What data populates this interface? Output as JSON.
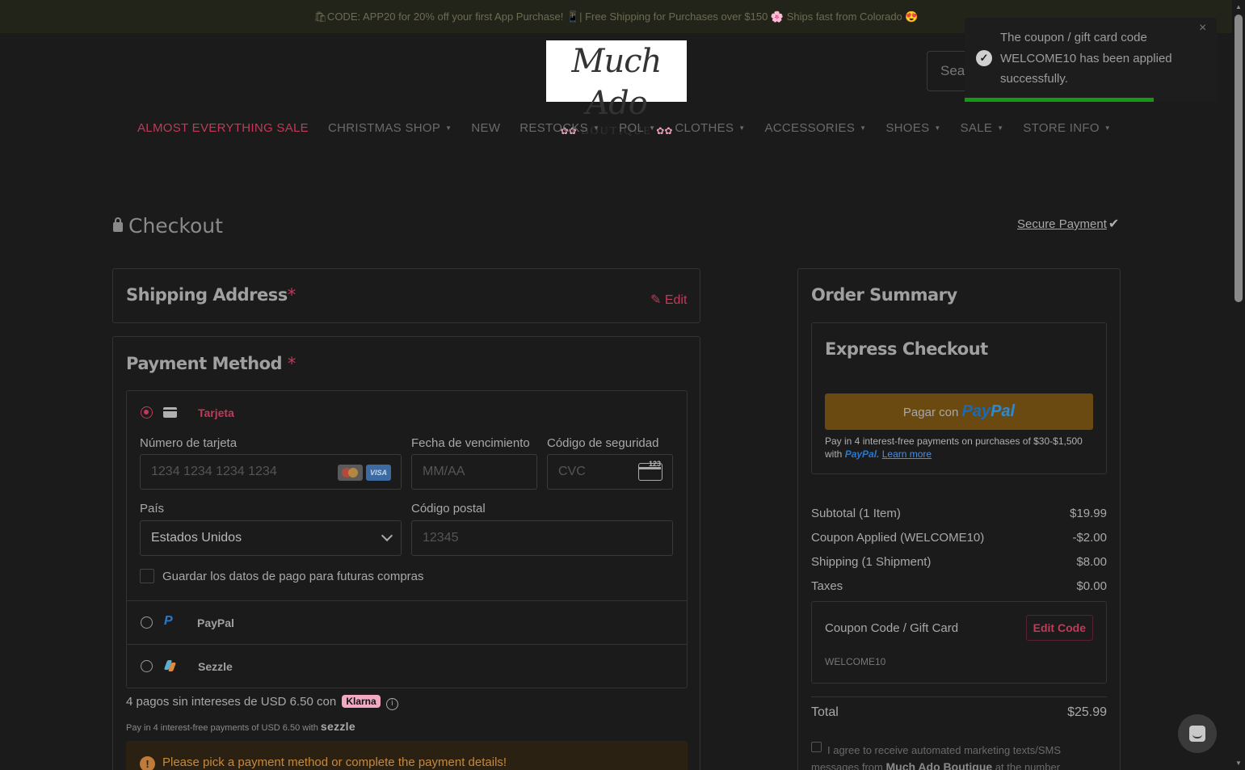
{
  "promo": {
    "text": "🛍CODE: APP20 for 20% off your first App Purchase! 📱| Free Shipping for Purchases over $150 🌸 Ships fast from Colorado 😍"
  },
  "logo": {
    "script": "Much Ado",
    "sub": "BOUTIQUE"
  },
  "search": {
    "placeholder": "Sea"
  },
  "toast": {
    "message": "The coupon / gift card code WELCOME10 has been applied successfully.",
    "close": "×"
  },
  "nav": {
    "items": [
      {
        "label": "ALMOST EVERYTHING SALE",
        "caret": ""
      },
      {
        "label": "CHRISTMAS SHOP",
        "caret": "▼"
      },
      {
        "label": "NEW",
        "caret": ""
      },
      {
        "label": "RESTOCKS",
        "caret": "▼"
      },
      {
        "label": "POL",
        "caret": "▼"
      },
      {
        "label": "CLOTHES",
        "caret": "▼"
      },
      {
        "label": "ACCESSORIES",
        "caret": "▼"
      },
      {
        "label": "SHOES",
        "caret": "▼"
      },
      {
        "label": "SALE",
        "caret": "▼"
      },
      {
        "label": "STORE INFO",
        "caret": "▼"
      }
    ]
  },
  "page": {
    "title": "Checkout",
    "secure": "Secure Payment",
    "secure_check": "✔"
  },
  "shipping": {
    "title": "Shipping Address",
    "required": "*",
    "edit": "Edit",
    "edit_icon": "✎"
  },
  "payment": {
    "title": "Payment Method",
    "required": "*",
    "card_option": "Tarjeta",
    "card_number_label": "Número de tarjeta",
    "card_number_placeholder": "1234 1234 1234 1234",
    "expiry_label": "Fecha de vencimiento",
    "expiry_placeholder": "MM/AA",
    "cvc_label": "Código de seguridad",
    "cvc_placeholder": "CVC",
    "cvc_icon_text": "123",
    "visa": "VISA",
    "country_label": "País",
    "country_value": "Estados Unidos",
    "postal_label": "Código postal",
    "postal_placeholder": "12345",
    "save_label": "Guardar los datos de pago para futuras compras",
    "paypal_option": "PayPal",
    "paypal_icon": "P",
    "sezzle_option": "Sezzle",
    "klarna_text": "4 pagos sin intereses de USD 6.50 con",
    "klarna_badge": "Klarna",
    "info_icon": "i",
    "sezzle_text": "Pay in 4 interest-free payments of USD 6.50 with",
    "sezzle_logo": "sezzle",
    "alert_icon": "!",
    "alert": "Please pick a payment method or complete the payment details!"
  },
  "summary": {
    "title": "Order Summary",
    "express_title": "Express Checkout",
    "paypal_btn": "Pagar con",
    "paypal_logo_a": "Pay",
    "paypal_logo_b": "Pal",
    "pay4_text": "Pay in 4 interest-free payments on purchases of $30-$1,500 with",
    "pay4_pp": "PayPal.",
    "pay4_link": "Learn more",
    "rows": [
      {
        "label": "Subtotal (1 Item)",
        "value": "$19.99"
      },
      {
        "label": "Coupon Applied (WELCOME10)",
        "value": "-$2.00"
      },
      {
        "label": "Shipping (1 Shipment)",
        "value": "$8.00"
      },
      {
        "label": "Taxes",
        "value": "$0.00"
      }
    ],
    "coupon_label": "Coupon Code / Gift Card",
    "edit_code": "Edit Code",
    "coupon_code": "WELCOME10",
    "total_label": "Total",
    "total_value": "$25.99",
    "marketing_text": "I agree to receive automated marketing texts/SMS messages from",
    "marketing_brand": "Much Ado Boutique",
    "marketing_tail": "at the number"
  },
  "colors": {
    "accent": "#c03a5a",
    "background": "#1b1b1b",
    "toast_progress": "#139913",
    "paypal_button": "#6a4a10"
  }
}
